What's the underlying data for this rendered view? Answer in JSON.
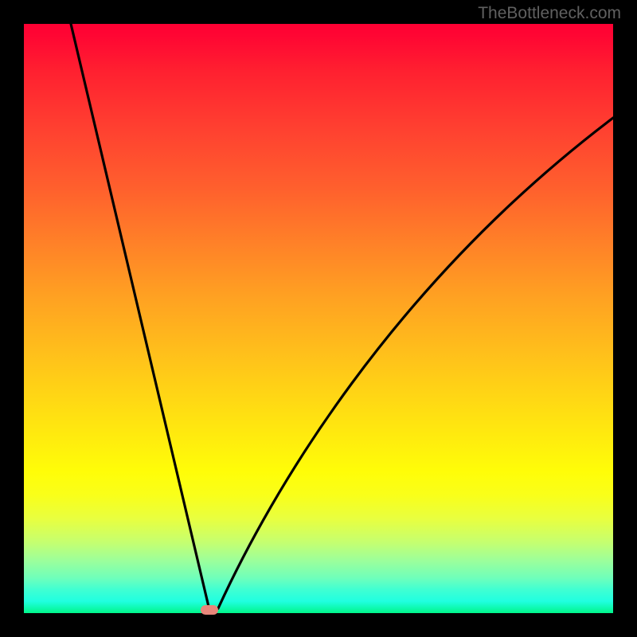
{
  "watermark": "TheBottleneck.com",
  "chart_data": {
    "type": "line",
    "title": "",
    "xlabel": "",
    "ylabel": "",
    "xlim": [
      0,
      100
    ],
    "ylim": [
      0,
      100
    ],
    "grid": false,
    "series": [
      {
        "name": "bottleneck-curve",
        "x": [
          8,
          12,
          16,
          20,
          24,
          28,
          30,
          31,
          31.5,
          32,
          34,
          36,
          40,
          46,
          52,
          60,
          70,
          80,
          90,
          100
        ],
        "y": [
          100,
          84,
          68,
          52,
          36,
          18,
          7,
          2,
          0,
          2,
          10,
          18,
          30,
          42,
          52,
          60,
          68,
          75,
          80,
          84
        ]
      }
    ],
    "annotations": [
      {
        "name": "min-marker",
        "x": 31.5,
        "y": 0
      }
    ],
    "background": {
      "type": "vertical-gradient",
      "stops": [
        {
          "pos": 0,
          "color": "#ff0033"
        },
        {
          "pos": 50,
          "color": "#ffc01b"
        },
        {
          "pos": 80,
          "color": "#fffd08"
        },
        {
          "pos": 100,
          "color": "#00f68a"
        }
      ]
    }
  }
}
